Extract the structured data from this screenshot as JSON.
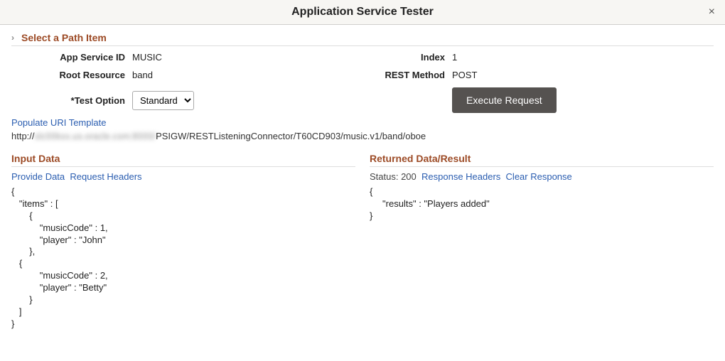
{
  "header": {
    "title": "Application Service Tester",
    "close_label": "×"
  },
  "path_section": {
    "title": "Select a Path Item",
    "app_service_id_label": "App Service ID",
    "app_service_id": "MUSIC",
    "index_label": "Index",
    "index": "1",
    "root_resource_label": "Root Resource",
    "root_resource": "band",
    "rest_method_label": "REST Method",
    "rest_method": "POST",
    "test_option_label": "Test Option",
    "test_option_value": "Standard",
    "execute_button_label": "Execute Request"
  },
  "uri": {
    "populate_link": "Populate URI Template",
    "prefix": "http://",
    "blurred": "slc00kxx.us.oracle.com:8000/",
    "suffix": "PSIGW/RESTListeningConnector/T60CD903/music.v1/band/oboe"
  },
  "input": {
    "header": "Input Data",
    "provide_data_link": "Provide Data",
    "request_headers_link": "Request Headers",
    "body": "{\n   \"items\" : [\n       {\n           \"musicCode\" : 1,\n           \"player\" : \"John\"\n       },\n   {\n           \"musicCode\" : 2,\n           \"player\" : \"Betty\"\n       }\n   ]\n}"
  },
  "output": {
    "header": "Returned Data/Result",
    "status_label": "Status: 200",
    "response_headers_link": "Response Headers",
    "clear_response_link": "Clear Response",
    "body": "{\n     \"results\" : \"Players added\"\n}"
  }
}
